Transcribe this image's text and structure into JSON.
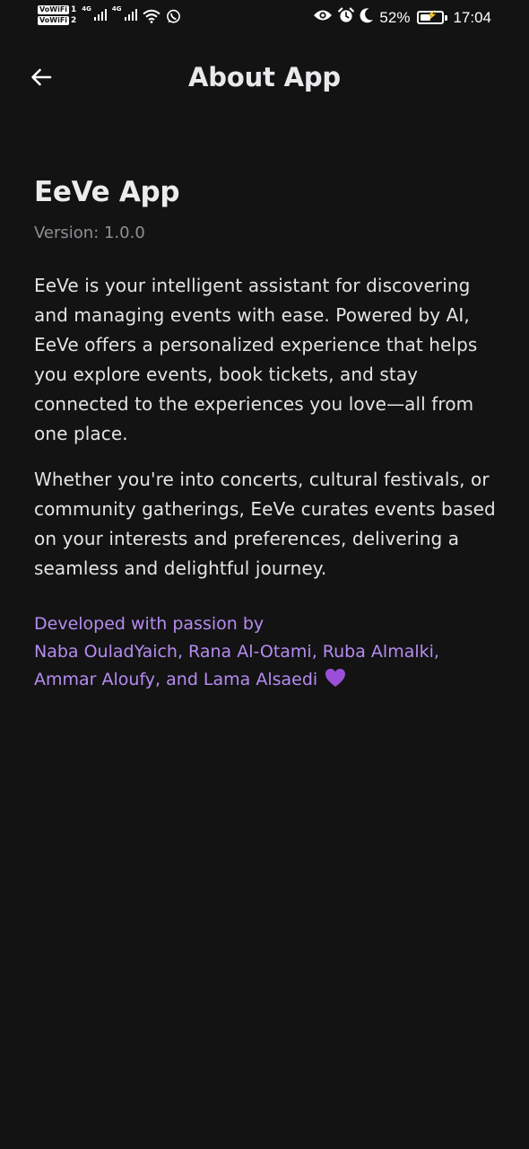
{
  "status_bar": {
    "sim1_label": "VoWiFi",
    "sim1_number": "1",
    "sim2_label": "VoWiFi",
    "sim2_number": "2",
    "network1": "4G",
    "network2": "4G",
    "battery_percent": "52%",
    "battery_level": 0.52,
    "time": "17:04",
    "icons": [
      "wifi-icon",
      "whatsapp-icon",
      "eye-icon",
      "alarm-icon",
      "moon-icon",
      "battery-icon"
    ]
  },
  "header": {
    "title": "About App",
    "back_icon": "arrow-left-icon"
  },
  "about": {
    "app_name": "EeVe App",
    "version": "Version: 1.0.0",
    "paragraph_1": "EeVe is your intelligent assistant for discovering and managing events with ease. Powered by AI, EeVe offers a personalized experience that helps you explore events, book tickets, and stay connected to the experiences you love—all from one place.",
    "paragraph_2": "Whether you're into concerts, cultural festivals, or community gatherings, EeVe curates events based on your interests and preferences, delivering a seamless and delightful journey.",
    "credits_line_1": "Developed with passion by",
    "credits_line_2": "Naba OuladYaich, Rana Al-Otami, Ruba Almalki,",
    "credits_line_3": "Ammar Aloufy, and Lama Alsaedi",
    "credits_icon": "purple-heart-icon"
  },
  "colors": {
    "background": "#131314",
    "text_primary": "#e4e4e7",
    "text_secondary": "#8f8f95",
    "accent": "#b58cf0",
    "heart": "#9b4fd6"
  }
}
